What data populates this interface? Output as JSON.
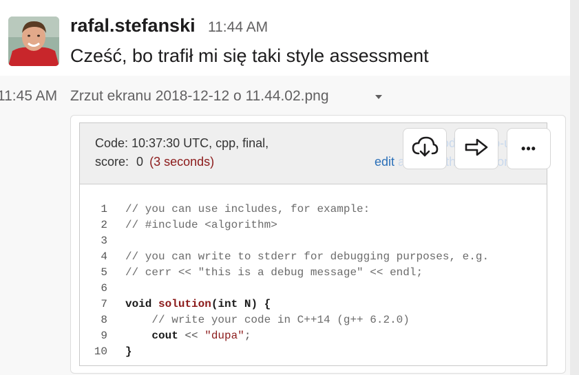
{
  "message1": {
    "author": "rafal.stefanski",
    "time": "11:44 AM",
    "text": "Cześć, bo trafił mi się taki style assessment"
  },
  "message2": {
    "time": "11:45 AM",
    "filename": "Zrzut ekranu 2018-12-12 o 11.44.02.png"
  },
  "screenshot": {
    "header_line1": "Code: 10:37:30 UTC, cpp, final,",
    "score_label": "score:",
    "score_value": "0",
    "score_time": "(3 seconds)",
    "show_link": "show code in pop-up",
    "edit_link": "edit",
    "edit_link_rest": " and test this solution",
    "lines": [
      {
        "num": "1",
        "text": "// you can use includes, for example:"
      },
      {
        "num": "2",
        "text": "// #include <algorithm>"
      },
      {
        "num": "3",
        "text": ""
      },
      {
        "num": "4",
        "text": "// you can write to stderr for debugging purposes, e.g."
      },
      {
        "num": "5",
        "text": "// cerr << \"this is a debug message\" << endl;"
      },
      {
        "num": "6",
        "text": ""
      },
      {
        "num": "7",
        "text": ""
      },
      {
        "num": "8",
        "text": "    // write your code in C++14 (g++ 6.2.0)"
      },
      {
        "num": "9",
        "text": ""
      },
      {
        "num": "10",
        "text": "}"
      }
    ],
    "line7": {
      "kw1": "void",
      "fn": "solution",
      "open": "(",
      "kw2": "int",
      "rest": " N) {"
    },
    "line9": {
      "indent": "    ",
      "kw": "cout",
      "op": " << ",
      "str": "\"dupa\"",
      "end": ";"
    }
  },
  "actions": {
    "download_icon": "cloud-download-icon",
    "share_icon": "share-arrow-icon",
    "more_label": "•••"
  },
  "colors": {
    "accent_link": "#2a6fb8",
    "score_red": "#8b1a1a",
    "text": "#1d1c1d",
    "muted": "#616061"
  }
}
